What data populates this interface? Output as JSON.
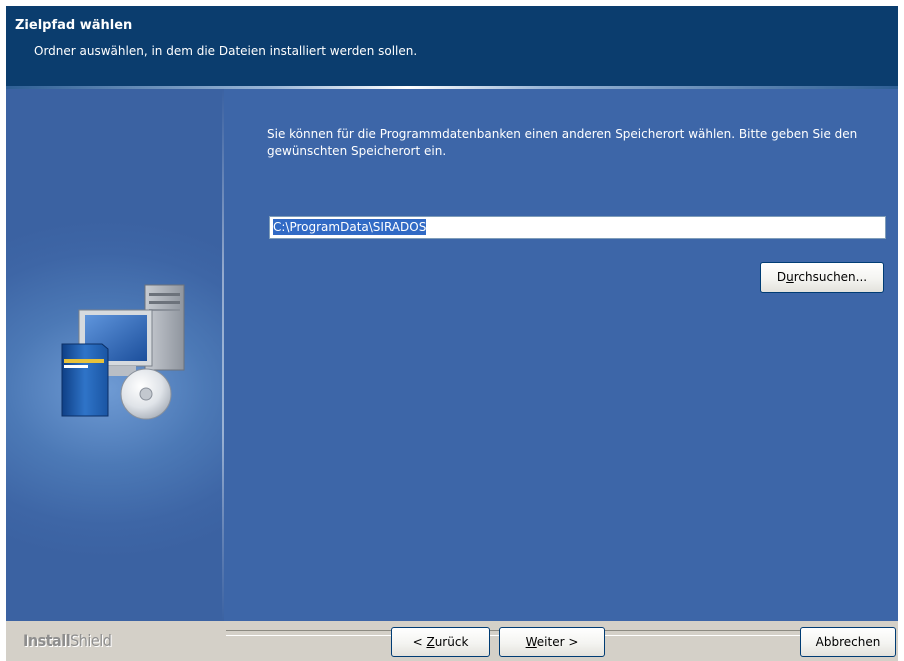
{
  "header": {
    "title": "Zielpfad wählen",
    "subtitle": "Ordner auswählen, in dem die Dateien installiert werden sollen."
  },
  "content": {
    "description": "Sie können für die Programmdatenbanken einen anderen Speicherort wählen. Bitte geben Sie den gewünschten Speicherort ein.",
    "path_value": "C:\\ProgramData\\SIRADOS",
    "browse_label_pre": "D",
    "browse_label_accel": "u",
    "browse_label_post": "rchsuchen..."
  },
  "footer": {
    "brand_bold": "Install",
    "brand_light": "Shield",
    "back_pre": "< ",
    "back_accel": "Z",
    "back_post": "urück",
    "next_accel": "W",
    "next_post": "eiter >",
    "cancel_label": "Abbrechen"
  },
  "colors": {
    "header_bg": "#0b3d6e",
    "panel_bg": "#3d66a8",
    "selection": "#316ac5",
    "chrome": "#d4d0c8"
  },
  "icons": {
    "side_art": "computer-setup-illustration-icon"
  }
}
